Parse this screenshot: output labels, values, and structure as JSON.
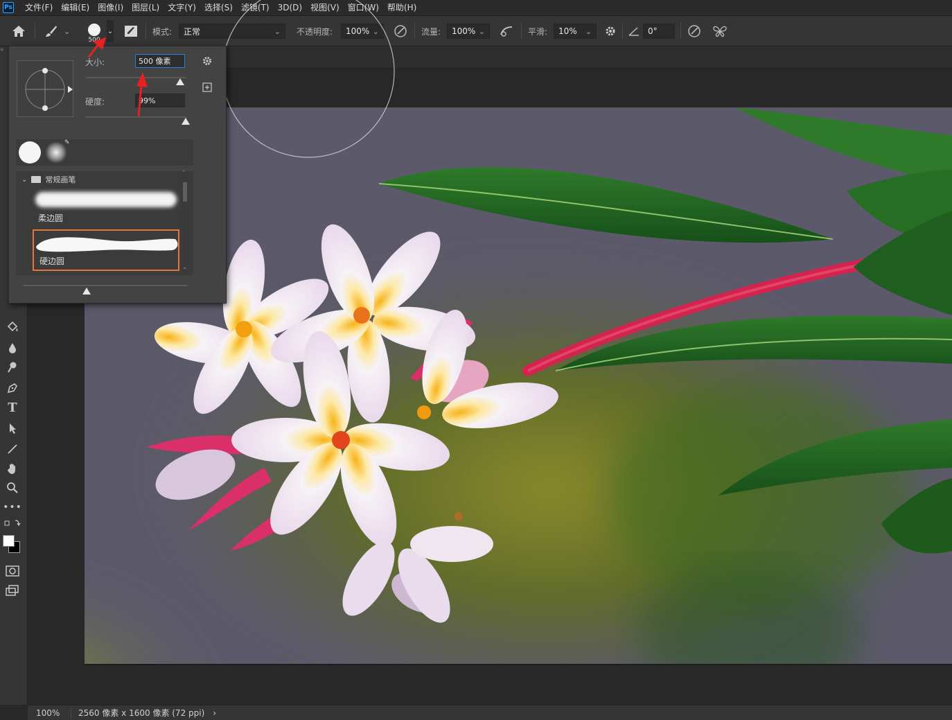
{
  "app": {
    "logo_text": "Ps"
  },
  "menu": [
    "文件(F)",
    "编辑(E)",
    "图像(I)",
    "图层(L)",
    "文字(Y)",
    "选择(S)",
    "滤镜(T)",
    "3D(D)",
    "视图(V)",
    "窗口(W)",
    "帮助(H)"
  ],
  "options": {
    "brush_size_badge": "500",
    "mode_label": "模式:",
    "mode_value": "正常",
    "opacity_label": "不透明度:",
    "opacity_value": "100%",
    "flow_label": "流量:",
    "flow_value": "100%",
    "smoothing_label": "平滑:",
    "smoothing_value": "10%",
    "angle_value": "0°"
  },
  "brush_panel": {
    "size_label": "大小:",
    "size_value": "500 像素",
    "hardness_label": "硬度:",
    "hardness_value": "99%",
    "size_slider_level": 0.94,
    "hardness_slider_level": 0.99,
    "group_name": "常规画笔",
    "brushes": [
      {
        "name": "柔边圆",
        "selected": false
      },
      {
        "name": "硬边圆",
        "selected": true
      }
    ]
  },
  "status": {
    "zoom": "100%",
    "doc_info": "2560 像素 x 1600 像素 (72 ppi)",
    "arrow": "›"
  },
  "colors": {
    "accent_orange": "#e4773a",
    "annotation_red": "#e52121",
    "selected_field_border": "#2f7fd8"
  },
  "icons": {
    "home": "home-icon",
    "brush": "brush-icon",
    "settings": "gear-icon",
    "airbrush": "airbrush-icon",
    "angle": "angle-icon",
    "symmetry": "butterfly-icon"
  }
}
